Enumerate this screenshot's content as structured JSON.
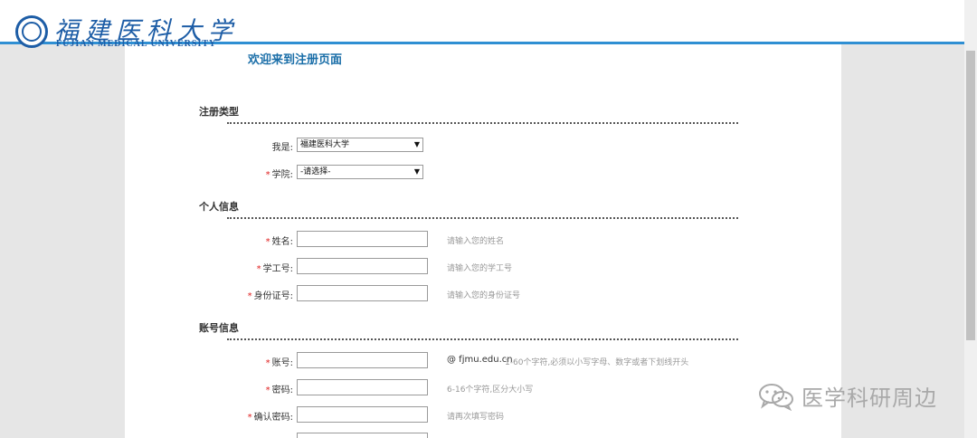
{
  "header": {
    "logo_cn": "福建医科大学",
    "logo_en": "FUJIAN MEDICAL UNIVERSITY",
    "accent_color": "#2f8fd3",
    "brand_color": "#1d5da6"
  },
  "page": {
    "welcome": "欢迎来到注册页面"
  },
  "sections": {
    "registration_type": {
      "title": "注册类型",
      "identity": {
        "label": "我是:",
        "value": "福建医科大学"
      },
      "college": {
        "required_mark": "*",
        "label": "学院:",
        "value": "-请选择-"
      }
    },
    "personal_info": {
      "title": "个人信息",
      "name": {
        "required_mark": "*",
        "label": "姓名:",
        "value": "",
        "hint": "请输入您的姓名"
      },
      "staff_id": {
        "required_mark": "*",
        "label": "学工号:",
        "value": "",
        "hint": "请输入您的学工号"
      },
      "id_number": {
        "required_mark": "*",
        "label": "身份证号:",
        "value": "",
        "hint": "请输入您的身份证号"
      }
    },
    "account_info": {
      "title": "账号信息",
      "account": {
        "required_mark": "*",
        "label": "账号:",
        "value": "",
        "domain": "@ fjmu.edu.cn",
        "hint": "1-60个字符,必须以小写字母、数字或者下划线开头"
      },
      "password": {
        "required_mark": "*",
        "label": "密码:",
        "value": "",
        "hint": "6-16个字符,区分大小写"
      },
      "confirm_password": {
        "required_mark": "*",
        "label": "确认密码:",
        "value": "",
        "hint": "请再次填写密码"
      }
    }
  },
  "watermark": {
    "text": "医学科研周边",
    "icon": "wechat-icon"
  }
}
